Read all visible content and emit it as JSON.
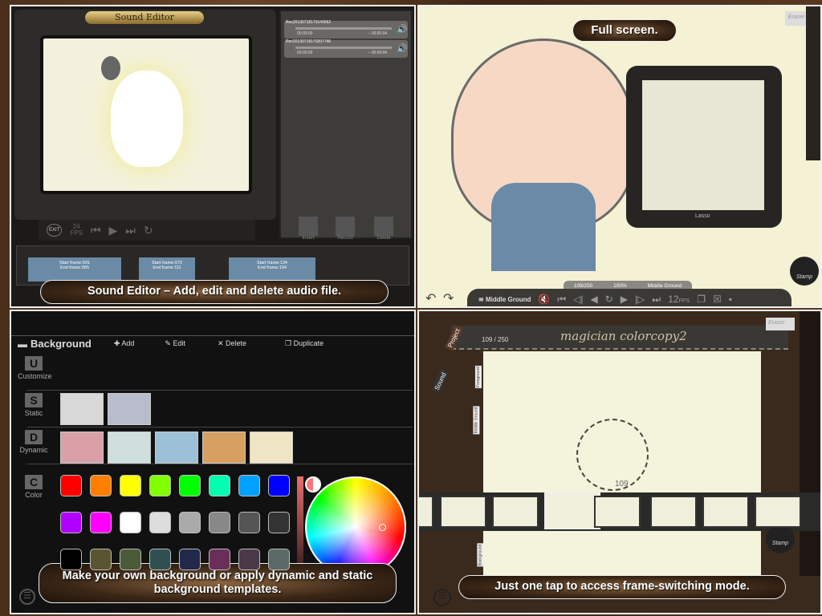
{
  "sound_editor": {
    "title": "Sound Editor",
    "tracks": [
      {
        "name": "Rec20130718170143662",
        "start": "00:00:00",
        "end": "-- 00:00:04"
      },
      {
        "name": "Rec20130718170207746",
        "start": "00:00:00",
        "end": "-- 00:00:04"
      }
    ],
    "controls": {
      "exit": "EXIT",
      "fps": "24",
      "fps_unit": "FPS"
    },
    "actions": [
      "Insert",
      "Record",
      "Delete"
    ],
    "clips": [
      {
        "start": "Start frame:001",
        "end": "End frame:065"
      },
      {
        "start": "Start frame:072",
        "end": "End frame:111"
      },
      {
        "start": "Start frame:134",
        "end": "End frame:194"
      }
    ],
    "caption": "Sound Editor – Add, edit and delete audio file."
  },
  "full_screen": {
    "caption": "Full screen.",
    "status": {
      "frame": "109/250",
      "zoom": "100%",
      "layer": "Middle Ground"
    },
    "layer_button": "Middle Ground",
    "fps": "12",
    "fps_unit": "FPS",
    "lasso_label": "Lasso",
    "eraser_label": "Eraser",
    "stamp_label": "Stamp"
  },
  "background": {
    "title": "Background",
    "toolbar": [
      "Add",
      "Edit",
      "Delete",
      "Duplicate"
    ],
    "categories": [
      {
        "letter": "U",
        "label": "Customize"
      },
      {
        "letter": "S",
        "label": "Static"
      },
      {
        "letter": "D",
        "label": "Dynamic"
      },
      {
        "letter": "C",
        "label": "Color"
      }
    ],
    "static_thumbs": [
      "#d8d8d8",
      "#b8bccc"
    ],
    "dynamic_thumbs": [
      "#d9a0a8",
      "#cfe0dc",
      "#9cc0d8",
      "#d8a060",
      "#efe4c4"
    ],
    "swatches": [
      "#ff0000",
      "#ff8000",
      "#ffff00",
      "#80ff00",
      "#00ff00",
      "#00ffb0",
      "#00a0ff",
      "#0000ff",
      "#b000ff",
      "#ff00ff",
      "#ffffff",
      "#dddddd",
      "#aaaaaa",
      "#888888",
      "#555555",
      "#333333",
      "#000000",
      "#5a5530",
      "#4a5a38",
      "#2e5050",
      "#22284a",
      "#6a2e5a",
      "#4a3a48",
      "#5a6a66"
    ],
    "caption": "Make your own background or apply dynamic and static background templates."
  },
  "frame_switch": {
    "title": "magician colorcopy2",
    "counter": "109 / 250",
    "current_frame": "109",
    "tabs": [
      "Project",
      "Sound"
    ],
    "layers": [
      "Foreground",
      "Middle Ground",
      "Background"
    ],
    "eraser_label": "Eraser",
    "stamp_label": "Stamp",
    "caption": "Just one tap to access frame-switching mode."
  }
}
